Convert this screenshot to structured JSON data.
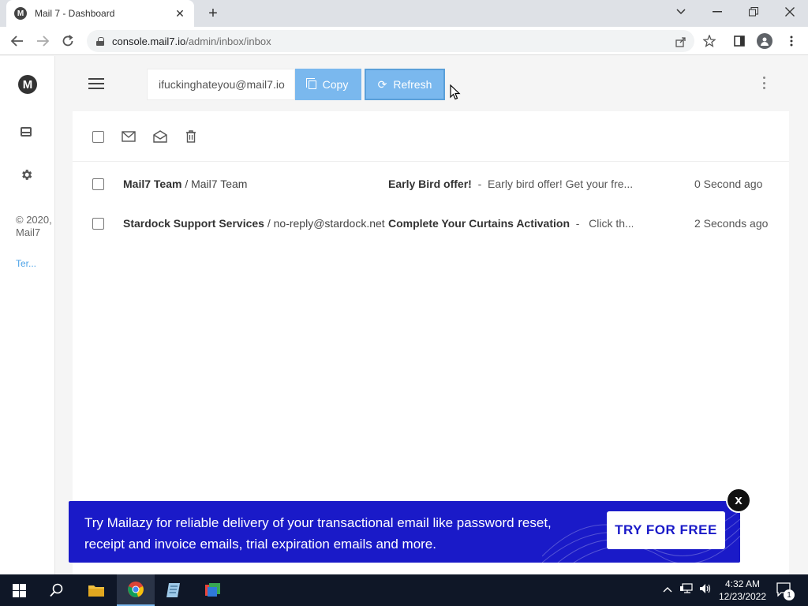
{
  "browser": {
    "tab_title": "Mail 7 - Dashboard",
    "tab_favicon": "M",
    "tab_close": "✕",
    "new_tab": "+",
    "url_host": "console.mail7.io",
    "url_path": "/admin/inbox/inbox"
  },
  "app": {
    "logo_letter": "M",
    "copyright": "© 2020, Mail7",
    "terms": "Ter...",
    "email_value": "ifuckinghateyou@mail7.io",
    "copy_label": "Copy",
    "refresh_label": "Refresh",
    "refresh_glyph": "⟳"
  },
  "emails": [
    {
      "sender_name": "Mail7 Team",
      "sender_addr": "Mail7 Team",
      "subject": "Early Bird offer!",
      "preview": "Early bird offer! Get your fre...",
      "time": "0 Second ago"
    },
    {
      "sender_name": "Stardock Support Services",
      "sender_addr": "no-reply@stardock.net",
      "subject": "Complete Your Curtains Activation",
      "preview": "Click th...",
      "time": "2 Seconds ago"
    }
  ],
  "banner": {
    "text": "Try Mailazy for reliable delivery of your transactional email like password reset, receipt and invoice emails, trial expiration emails and more.",
    "button": "TRY FOR FREE",
    "close": "x"
  },
  "taskbar": {
    "time": "4:32 AM",
    "date": "12/23/2022",
    "notification_count": "1"
  },
  "colors": {
    "accent": "#7ab8ee",
    "banner_bg": "#1a1ac8"
  }
}
